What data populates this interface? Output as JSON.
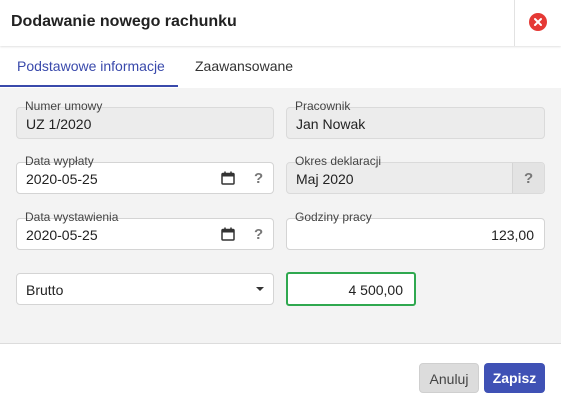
{
  "dialog": {
    "title": "Dodawanie nowego rachunku",
    "close_icon": "close-icon",
    "accent_color": "#3949ab",
    "close_color": "#e53935"
  },
  "tabs": [
    {
      "label": "Podstawowe informacje",
      "active": true
    },
    {
      "label": "Zaawansowane",
      "active": false
    }
  ],
  "form": {
    "contract_number": {
      "label": "Numer umowy",
      "value": "UZ 1/2020"
    },
    "employee": {
      "label": "Pracownik",
      "value": "Jan Nowak"
    },
    "payout_date": {
      "label": "Data wypłaty",
      "value": "2020-05-25",
      "help": "?"
    },
    "declaration_period": {
      "label": "Okres deklaracji",
      "value": "Maj 2020",
      "help": "?"
    },
    "issue_date": {
      "label": "Data wystawienia",
      "value": "2020-05-25",
      "help": "?"
    },
    "work_hours": {
      "label": "Godziny pracy",
      "value": "123,00"
    },
    "amount_type": {
      "value": "Brutto"
    },
    "amount": {
      "value": "4 500,00",
      "border_color": "#2fa84f"
    }
  },
  "footer": {
    "cancel_label": "Anuluj",
    "save_label": "Zapisz",
    "save_color": "#3f51b5"
  }
}
